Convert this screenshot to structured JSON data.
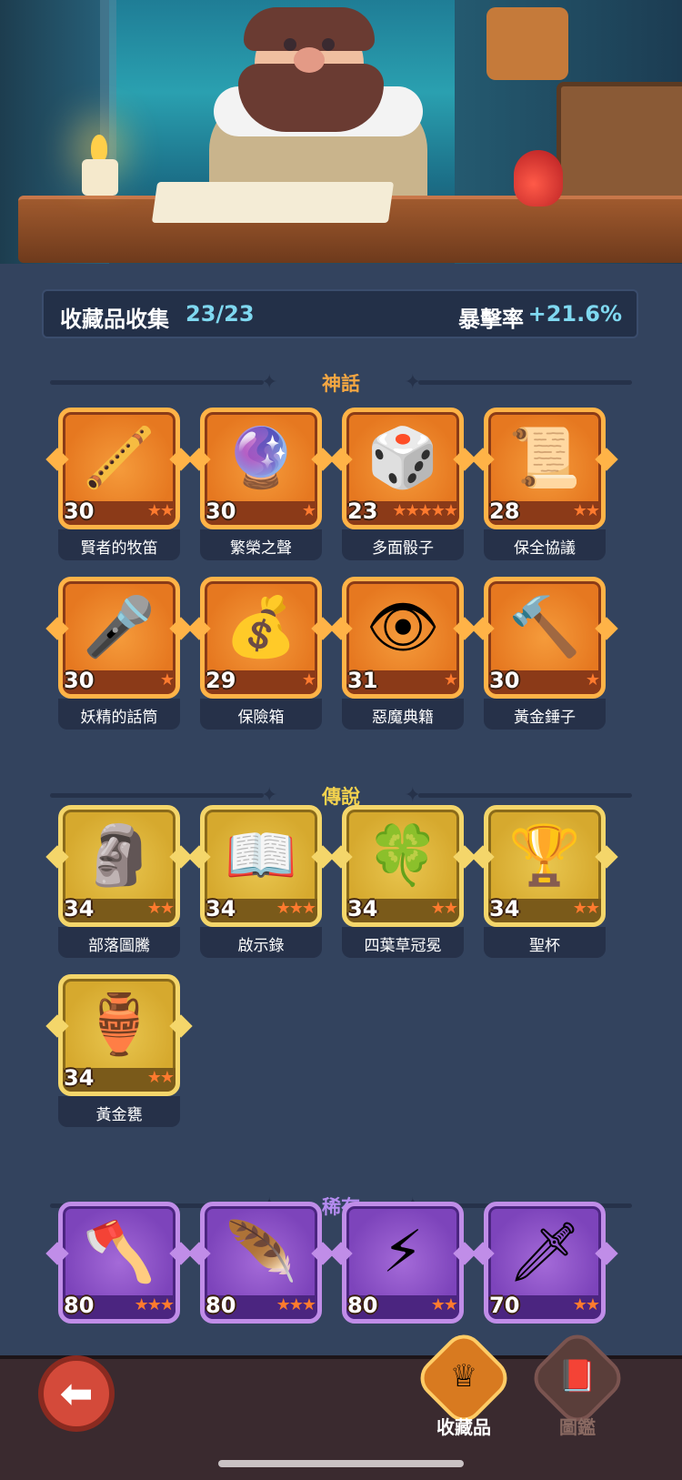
{
  "summary": {
    "collection_label": "收藏品收集",
    "collection_count": "23/23",
    "crit_label": "暴擊率",
    "crit_value": "+21.6%"
  },
  "sections": {
    "mythic": {
      "title": "神話",
      "color": "#f5a742"
    },
    "legendary": {
      "title": "傳說",
      "color": "#f3d24e"
    },
    "rare": {
      "title": "稀有",
      "color": "#b58cf0"
    }
  },
  "mythic_items": [
    {
      "name": "賢者的牧笛",
      "level": "30",
      "stars": "★★",
      "icon": "flute-icon",
      "glyph": "🪈"
    },
    {
      "name": "繁榮之聲",
      "level": "30",
      "stars": "★",
      "icon": "orb-icon",
      "glyph": "🔮"
    },
    {
      "name": "多面骰子",
      "level": "23",
      "stars": "★★★★★",
      "icon": "dice-icon",
      "glyph": "🎲"
    },
    {
      "name": "保全協議",
      "level": "28",
      "stars": "★★",
      "icon": "scroll-icon",
      "glyph": "📜"
    },
    {
      "name": "妖精的話筒",
      "level": "30",
      "stars": "★",
      "icon": "microphone-icon",
      "glyph": "🎤"
    },
    {
      "name": "保險箱",
      "level": "29",
      "stars": "★",
      "icon": "treasure-chest-icon",
      "glyph": "💰"
    },
    {
      "name": "惡魔典籍",
      "level": "31",
      "stars": "★",
      "icon": "eye-tome-icon",
      "glyph": "👁"
    },
    {
      "name": "黃金錘子",
      "level": "30",
      "stars": "★",
      "icon": "hammer-icon",
      "glyph": "🔨"
    }
  ],
  "legendary_items": [
    {
      "name": "部落圖騰",
      "level": "34",
      "stars": "★★",
      "icon": "totem-icon",
      "glyph": "🗿"
    },
    {
      "name": "啟示錄",
      "level": "34",
      "stars": "★★★",
      "icon": "book-icon",
      "glyph": "📖"
    },
    {
      "name": "四葉草冠冕",
      "level": "34",
      "stars": "★★",
      "icon": "clover-crown-icon",
      "glyph": "🍀"
    },
    {
      "name": "聖杯",
      "level": "34",
      "stars": "★★",
      "icon": "chalice-icon",
      "glyph": "🏆"
    },
    {
      "name": "黃金甕",
      "level": "34",
      "stars": "★★",
      "icon": "golden-urn-icon",
      "glyph": "🏺"
    }
  ],
  "rare_items": [
    {
      "name": "",
      "level": "80",
      "stars": "★★★",
      "icon": "axe-icon",
      "glyph": "🪓"
    },
    {
      "name": "",
      "level": "80",
      "stars": "★★★",
      "icon": "feather-icon",
      "glyph": "🪶"
    },
    {
      "name": "",
      "level": "80",
      "stars": "★★",
      "icon": "lightning-card-icon",
      "glyph": "⚡"
    },
    {
      "name": "",
      "level": "70",
      "stars": "★★",
      "icon": "dagger-icon",
      "glyph": "🗡"
    }
  ],
  "nav": {
    "back_glyph": "⬅",
    "tab_collection": "收藏品",
    "tab_codex": "圖鑑",
    "tab_collection_glyph": "♕",
    "tab_codex_glyph": "📕"
  }
}
